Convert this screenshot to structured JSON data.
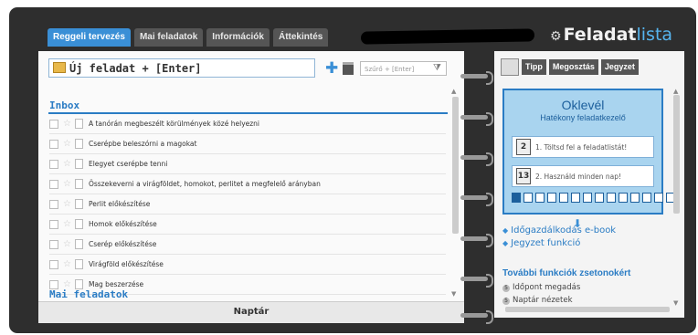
{
  "header": {
    "tabs": [
      "Reggeli tervezés",
      "Mai feladatok",
      "Információk",
      "Áttekintés"
    ],
    "brand_main": "Feladat",
    "brand_accent": "lista"
  },
  "left": {
    "new_task_placeholder": "Új feladat + [Enter]",
    "filter_placeholder": "Szűrő + [Enter]",
    "inbox_title": "Inbox",
    "tasks": [
      "A tanórán megbeszélt körülmények közé helyezni",
      "Cserépbe beleszórni a magokat",
      "Elegyet cserépbe tenni",
      "Összekeverni a virágföldet, homokot, perlitet a megfelelő arányban",
      "Perlit előkészítése",
      "Homok előkészítése",
      "Cserép előkészítése",
      "Virágföld előkészítése",
      "Mag beszerzése"
    ],
    "mai_title": "Mai feladatok",
    "naptar": "Naptár"
  },
  "right": {
    "tabs": [
      "Tipp",
      "Megosztás",
      "Jegyzet"
    ],
    "oklevel_title": "Oklevél",
    "oklevel_subtitle": "Hatékony feladatkezelő",
    "step1_num": "2",
    "step1_text": "1. Töltsd fel a feladatlistát!",
    "step2_num": "13",
    "step2_text": "2. Használd minden nap!",
    "progress_filled": 1,
    "progress_total": 14,
    "links": [
      "Időgazdálkodás e-book",
      "Jegyzet funkció"
    ],
    "tovabbi": "További funkciók zsetonokért",
    "features": [
      "Időpont megadás",
      "Naptár nézetek"
    ]
  },
  "colors": {
    "accent": "#2a7cc4",
    "frame": "#2e2e2e"
  }
}
